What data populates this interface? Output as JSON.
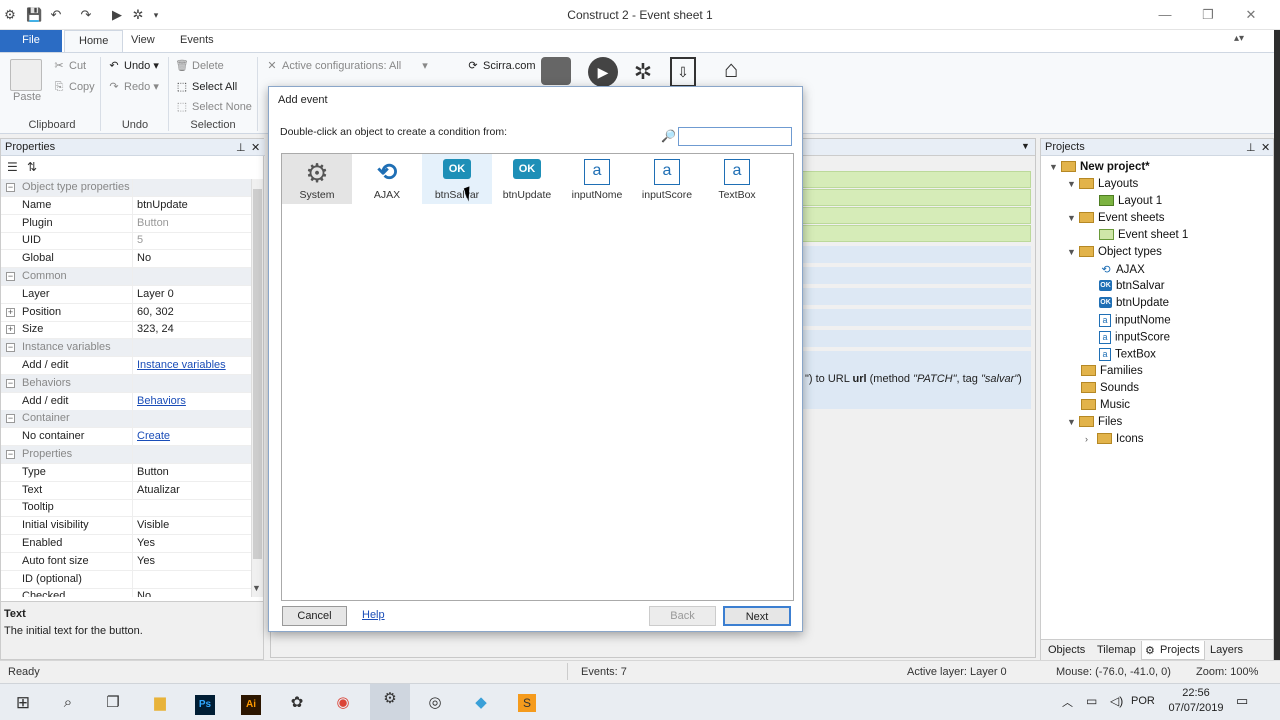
{
  "window": {
    "title": "Construct 2 - Event sheet 1"
  },
  "tabs": {
    "file": "File",
    "home": "Home",
    "view": "View",
    "events": "Events"
  },
  "ribbon": {
    "paste": "Paste",
    "cut": "Cut",
    "copy": "Copy",
    "undo": "Undo",
    "redo": "Redo",
    "delete": "Delete",
    "select_all": "Select All",
    "select_none": "Select None",
    "active_config": "Active configurations: All",
    "scirra": "Scirra.com",
    "groups": {
      "clipboard": "Clipboard",
      "undo": "Undo",
      "selection": "Selection"
    }
  },
  "properties": {
    "title": "Properties",
    "rows": [
      {
        "type": "cat",
        "k": "Object type properties"
      },
      {
        "k": "Name",
        "v": "btnUpdate"
      },
      {
        "k": "Plugin",
        "v": "Button",
        "grey": true
      },
      {
        "k": "UID",
        "v": "5",
        "grey": true
      },
      {
        "k": "Global",
        "v": "No"
      },
      {
        "type": "cat",
        "k": "Common"
      },
      {
        "k": "Layer",
        "v": "Layer 0"
      },
      {
        "k": "Position",
        "v": "60, 302",
        "exp": true
      },
      {
        "k": "Size",
        "v": "323, 24",
        "exp": true
      },
      {
        "type": "cat",
        "k": "Instance variables"
      },
      {
        "k": "Add / edit",
        "v": "Instance variables",
        "link": true
      },
      {
        "type": "cat",
        "k": "Behaviors"
      },
      {
        "k": "Add / edit",
        "v": "Behaviors",
        "link": true
      },
      {
        "type": "cat",
        "k": "Container"
      },
      {
        "k": "No container",
        "v": "Create",
        "link": true
      },
      {
        "type": "cat",
        "k": "Properties"
      },
      {
        "k": "Type",
        "v": "Button"
      },
      {
        "k": "Text",
        "v": "Atualizar"
      },
      {
        "k": "Tooltip",
        "v": ""
      },
      {
        "k": "Initial visibility",
        "v": "Visible"
      },
      {
        "k": "Enabled",
        "v": "Yes"
      },
      {
        "k": "Auto font size",
        "v": "Yes"
      },
      {
        "k": "ID (optional)",
        "v": ""
      },
      {
        "k": "Checked",
        "v": "No"
      }
    ],
    "help_title": "Text",
    "help_text": "The initial text for the button."
  },
  "sheet": {
    "event_text_pre": "\") to URL ",
    "event_url": "url",
    "event_mid": " (method ",
    "event_method": "\"PATCH\"",
    "event_tag_pre": ", tag ",
    "event_tag": "\"salvar\"",
    "event_end": ")"
  },
  "dialog": {
    "title": "Add event",
    "instruction": "Double-click an object to create a condition from:",
    "search_value": "",
    "objects": [
      {
        "name": "System",
        "icon": "gear-icon"
      },
      {
        "name": "AJAX",
        "icon": "ajax-icon"
      },
      {
        "name": "btnSalvar",
        "icon": "button-ok-icon"
      },
      {
        "name": "btnUpdate",
        "icon": "button-ok-icon"
      },
      {
        "name": "inputNome",
        "icon": "textbox-icon"
      },
      {
        "name": "inputScore",
        "icon": "textbox-icon"
      },
      {
        "name": "TextBox",
        "icon": "textbox-icon"
      }
    ],
    "cancel": "Cancel",
    "help": "Help",
    "back": "Back",
    "next": "Next"
  },
  "projects": {
    "title": "Projects",
    "root": "New project*",
    "layouts": "Layouts",
    "layout1": "Layout 1",
    "event_sheets": "Event sheets",
    "event_sheet1": "Event sheet 1",
    "object_types": "Object types",
    "objects": [
      "AJAX",
      "btnSalvar",
      "btnUpdate",
      "inputNome",
      "inputScore",
      "TextBox"
    ],
    "families": "Families",
    "sounds": "Sounds",
    "music": "Music",
    "files": "Files",
    "icons": "Icons",
    "bottom_tabs": [
      "Objects",
      "Tilemap",
      "Projects",
      "Layers"
    ]
  },
  "status": {
    "ready": "Ready",
    "events": "Events: 7",
    "layer": "Active layer: Layer 0",
    "mouse": "Mouse: (-76.0, -41.0, 0)",
    "zoom": "Zoom: 100%"
  },
  "taskbar": {
    "lang": "POR",
    "time": "22:56",
    "date": "07/07/2019"
  },
  "colors": {
    "accent": "#2b6cc4",
    "event_green": "#d6ecb8",
    "event_blue": "#dde8f4"
  }
}
